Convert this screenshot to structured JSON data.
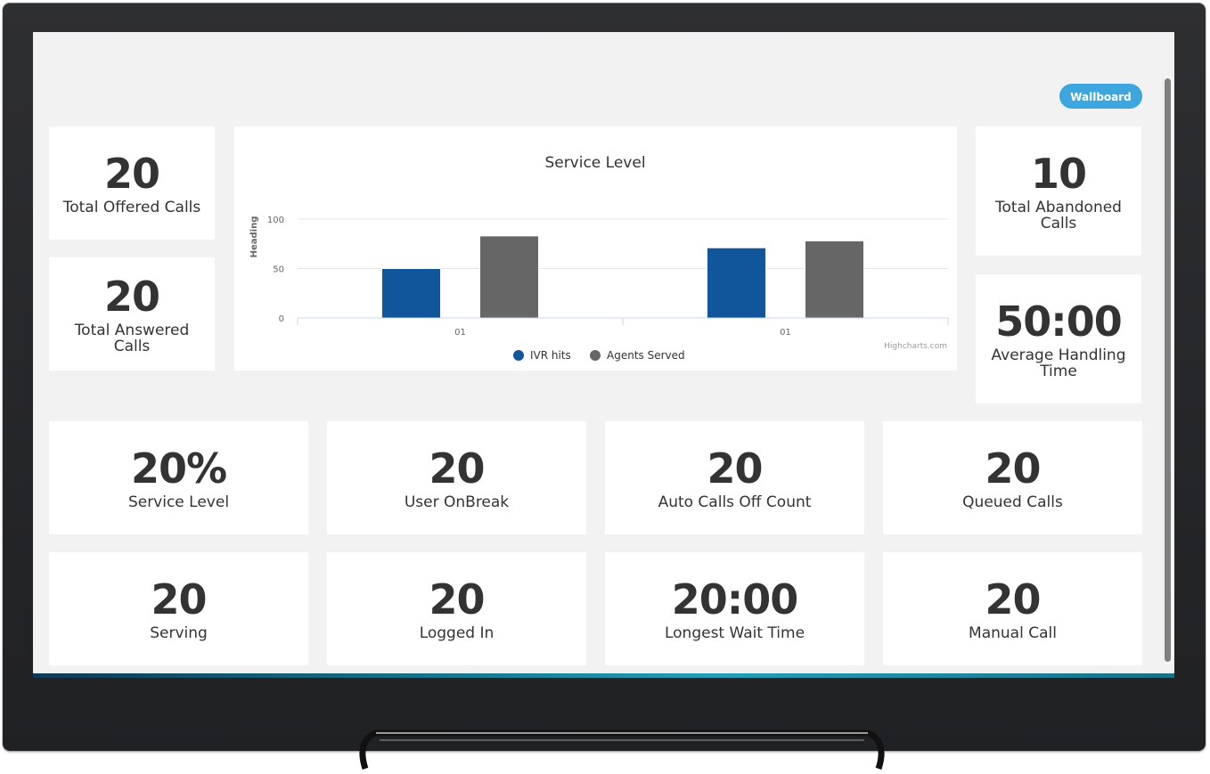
{
  "header": {
    "wallboard_button": "Wallboard"
  },
  "colors": {
    "accent": "#3ea6de",
    "ivr_series": "#11559a",
    "agents_series": "#666666",
    "background": "#f2f2f2",
    "card": "#ffffff"
  },
  "left_cards": [
    {
      "value": "20",
      "label": "Total Offered Calls"
    },
    {
      "value": "20",
      "label": "Total Answered Calls"
    }
  ],
  "right_cards": [
    {
      "value": "10",
      "label": "Total Abandoned Calls"
    },
    {
      "value": "50:00",
      "label": "Average Handling Time"
    }
  ],
  "grid_cards": [
    {
      "value": "20%",
      "label": "Service Level"
    },
    {
      "value": "20",
      "label": "User OnBreak"
    },
    {
      "value": "20",
      "label": "Auto Calls Off Count"
    },
    {
      "value": "20",
      "label": "Queued Calls"
    },
    {
      "value": "20",
      "label": "Serving"
    },
    {
      "value": "20",
      "label": "Logged In"
    },
    {
      "value": "20:00",
      "label": "Longest Wait Time"
    },
    {
      "value": "20",
      "label": "Manual Call"
    }
  ],
  "chart_data": {
    "type": "bar",
    "title": "Service Level",
    "xlabel": "",
    "ylabel": "Heading",
    "categories": [
      "01",
      "01"
    ],
    "series": [
      {
        "name": "IVR hits",
        "color": "#11559a",
        "values": [
          50,
          71
        ]
      },
      {
        "name": "Agents Served",
        "color": "#666666",
        "values": [
          83,
          78
        ]
      }
    ],
    "ylim": [
      0,
      100
    ],
    "yticks": [
      0,
      50,
      100
    ],
    "grid": true,
    "legend": "bottom-center",
    "credits": "Highcharts.com"
  }
}
